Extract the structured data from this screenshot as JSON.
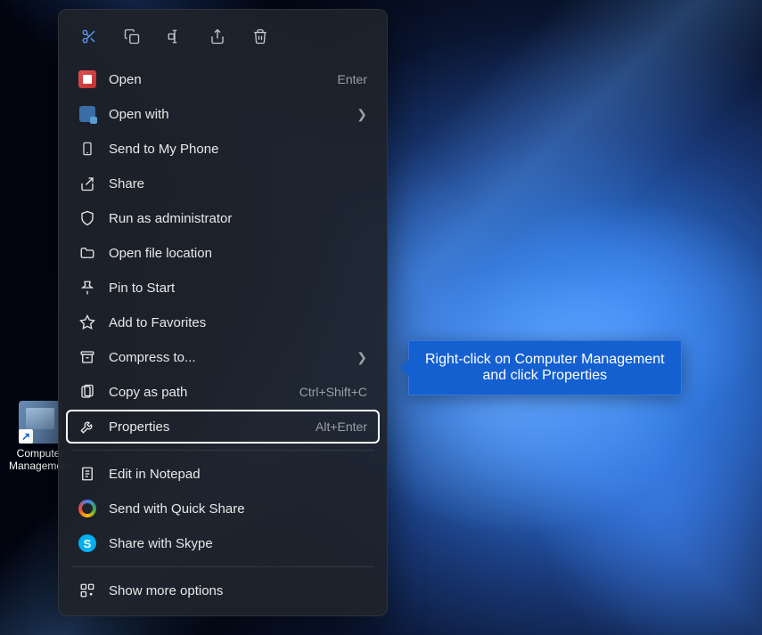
{
  "desktop": {
    "icon_label": "Computer Management"
  },
  "toolbar": {
    "cut": "Cut",
    "copy": "Copy",
    "rename": "Rename",
    "share": "Share",
    "delete": "Delete"
  },
  "menu": {
    "open": {
      "label": "Open",
      "shortcut": "Enter"
    },
    "open_with": {
      "label": "Open with"
    },
    "send_phone": {
      "label": "Send to My Phone"
    },
    "share": {
      "label": "Share"
    },
    "run_admin": {
      "label": "Run as administrator"
    },
    "open_location": {
      "label": "Open file location"
    },
    "pin_start": {
      "label": "Pin to Start"
    },
    "add_fav": {
      "label": "Add to Favorites"
    },
    "compress": {
      "label": "Compress to..."
    },
    "copy_path": {
      "label": "Copy as path",
      "shortcut": "Ctrl+Shift+C"
    },
    "properties": {
      "label": "Properties",
      "shortcut": "Alt+Enter"
    },
    "notepad": {
      "label": "Edit in Notepad"
    },
    "quickshare": {
      "label": "Send with Quick Share"
    },
    "skype": {
      "label": "Share with Skype"
    },
    "more": {
      "label": "Show more options"
    }
  },
  "tooltip": {
    "line1": "Right-click on Computer Management",
    "line2": "and click Properties"
  }
}
